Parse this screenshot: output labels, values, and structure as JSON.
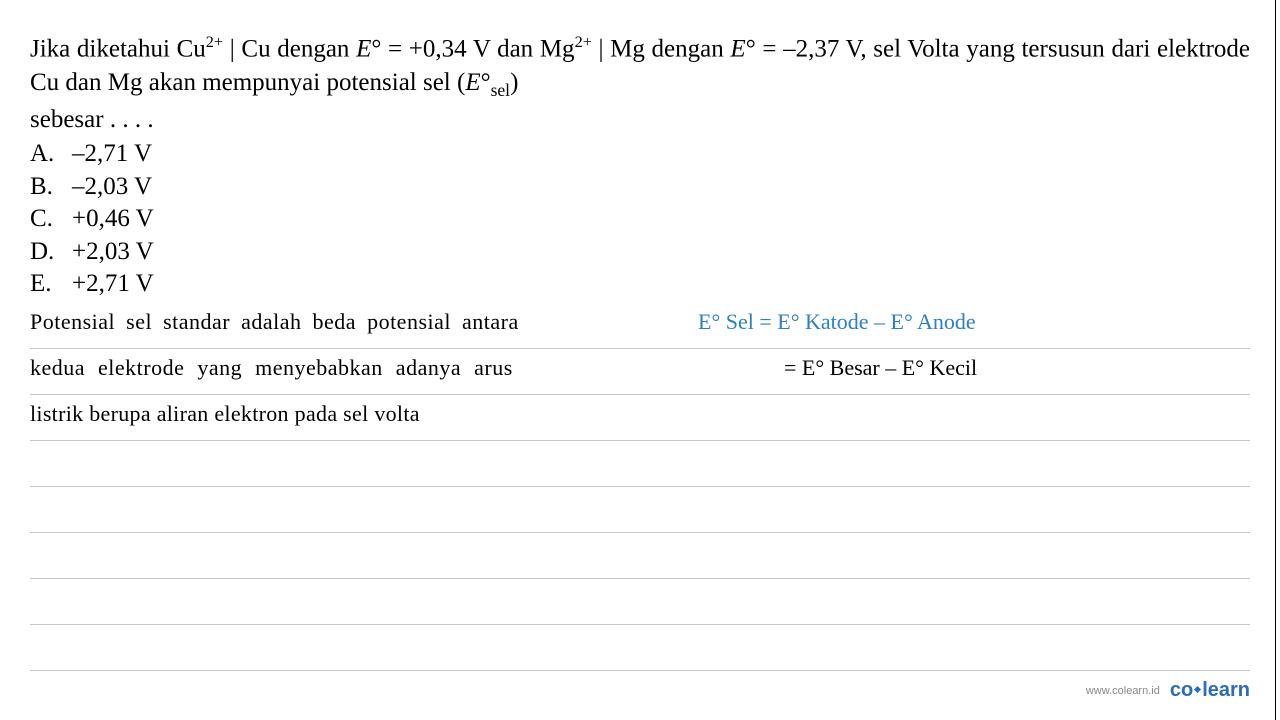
{
  "question": {
    "line1_part1": "Jika diketahui Cu",
    "line1_sup1": "2+",
    "line1_part2": " | Cu  dengan ",
    "line1_E": "E",
    "line1_deg": "°",
    "line1_part3": " = +0,34 V dan Mg",
    "line1_sup2": "2+",
    "line1_part4": " | Mg dengan ",
    "line1_part5": " = –2,37 V, sel",
    "line2": "Volta yang tersusun dari elektrode Cu dan Mg akan mempunyai potensial sel (",
    "line2_E": "E",
    "line2_deg": "°",
    "line2_sub": "sel",
    "line2_end": ")",
    "line3": "sebesar . . . ."
  },
  "options": {
    "a": {
      "letter": "A.",
      "text": "–2,71 V"
    },
    "b": {
      "letter": "B.",
      "text": "–2,03 V"
    },
    "c": {
      "letter": "C.",
      "text": "+0,46 V"
    },
    "d": {
      "letter": "D.",
      "text": "+2,03 V"
    },
    "e": {
      "letter": "E.",
      "text": "+2,71 V"
    }
  },
  "notes": {
    "black1": "Potensial sel standar adalah beda potensial antara",
    "black2": "kedua elektrode yang menyebabkan adanya arus",
    "black3": "listrik berupa aliran elektron pada sel volta",
    "blue1": "E° Sel = E° Katode – E° Anode",
    "eq2": "= E° Besar – E° Kecil"
  },
  "footer": {
    "url": "www.colearn.id",
    "brand_co": "co",
    "brand_learn": "learn"
  }
}
